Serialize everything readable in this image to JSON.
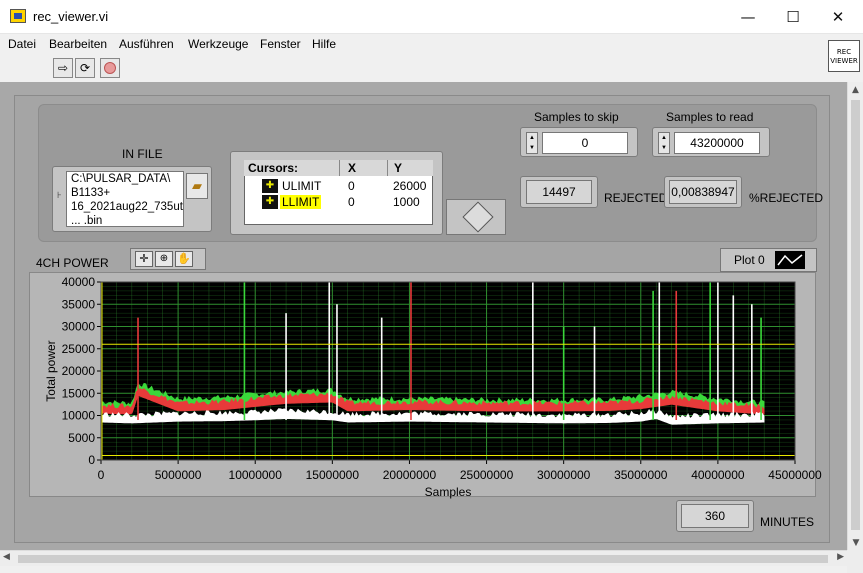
{
  "window": {
    "title": "rec_viewer.vi",
    "min": "—",
    "max": "☐",
    "close": "✕"
  },
  "menu": [
    "Datei",
    "Bearbeiten",
    "Ausführen",
    "Werkzeuge",
    "Fenster",
    "Hilfe"
  ],
  "vi_icon": {
    "line1": "REC",
    "line2": "VIEWER"
  },
  "infile": {
    "label": "IN FILE",
    "lines": [
      "C:\\PULSAR_DATA\\",
      "B1133+",
      "16_2021aug22_735ut",
      "... .bin"
    ]
  },
  "cursors": {
    "headers": [
      "Cursors:",
      "X",
      "Y"
    ],
    "rows": [
      {
        "name": "ULIMIT",
        "x": "0",
        "y": "26000"
      },
      {
        "name": "LLIMIT",
        "x": "0",
        "y": "1000"
      }
    ]
  },
  "skip": {
    "label": "Samples to skip",
    "value": "0"
  },
  "read": {
    "label": "Samples to read",
    "value": "43200000"
  },
  "rejected": {
    "value": "14497",
    "label": "REJECTED"
  },
  "pct_rejected": {
    "value": "0,00838947",
    "label": "%REJECTED"
  },
  "graph": {
    "label": "4CH POWER",
    "plot_legend": "Plot 0"
  },
  "minutes": {
    "value": "360",
    "label": "MINUTES"
  },
  "colors": {
    "plot_bg": "#000000",
    "grid": "#2f8f2f",
    "cursor": "#e8e800",
    "white_trace": "#ffffff",
    "red_trace": "#e83a3a",
    "green_trace": "#3ad83a"
  },
  "chart_data": {
    "type": "line",
    "title": "",
    "xlabel": "Samples",
    "ylabel": "Total power",
    "xlim": [
      0,
      45000000
    ],
    "ylim": [
      0,
      40000
    ],
    "x_ticks": [
      "0",
      "5000000",
      "10000000",
      "15000000",
      "20000000",
      "25000000",
      "30000000",
      "35000000",
      "40000000",
      "45000000"
    ],
    "y_ticks": [
      "0",
      "5000",
      "10000",
      "15000",
      "20000",
      "25000",
      "30000",
      "35000",
      "40000"
    ],
    "grid": true,
    "cursor_lines": [
      {
        "name": "ULIMIT",
        "y": 26000
      },
      {
        "name": "LLIMIT",
        "y": 1000
      }
    ],
    "series": [
      {
        "color": "green",
        "x": [
          0,
          2000000,
          2400000,
          5000000,
          8000000,
          10000000,
          12000000,
          15000000,
          16000000,
          20000000,
          25000000,
          30000000,
          33000000,
          35000000,
          37000000,
          40000000,
          43000000
        ],
        "y": [
          12800,
          12500,
          17000,
          13500,
          13800,
          14500,
          15000,
          15500,
          13500,
          13500,
          13200,
          13200,
          13300,
          14000,
          15000,
          13500,
          12500
        ]
      },
      {
        "color": "red",
        "x": [
          0,
          2000000,
          2400000,
          5000000,
          8000000,
          10000000,
          12000000,
          15000000,
          16000000,
          20000000,
          25000000,
          30000000,
          33000000,
          35000000,
          37000000,
          40000000,
          43000000
        ],
        "y": [
          12000,
          11800,
          16000,
          12500,
          12800,
          13500,
          14200,
          14500,
          12500,
          12800,
          12500,
          12500,
          12600,
          13000,
          14000,
          12500,
          11800
        ]
      },
      {
        "color": "white",
        "x": [
          0,
          2000000,
          5000000,
          8000000,
          10000000,
          12000000,
          15000000,
          16000000,
          20000000,
          25000000,
          30000000,
          33000000,
          35000000,
          36000000,
          37000000,
          40000000,
          43000000
        ],
        "y": [
          10000,
          9800,
          10200,
          10300,
          10500,
          10800,
          10500,
          10000,
          10200,
          10000,
          9800,
          9900,
          10200,
          10800,
          9500,
          9800,
          10000
        ]
      }
    ],
    "spikes": [
      {
        "x": 2400000,
        "y": 32000,
        "color": "red"
      },
      {
        "x": 9300000,
        "y": 40000,
        "color": "green"
      },
      {
        "x": 12000000,
        "y": 33000,
        "color": "white"
      },
      {
        "x": 14800000,
        "y": 40000,
        "color": "white"
      },
      {
        "x": 15300000,
        "y": 35000,
        "color": "white"
      },
      {
        "x": 18200000,
        "y": 32000,
        "color": "white"
      },
      {
        "x": 20100000,
        "y": 40000,
        "color": "red"
      },
      {
        "x": 28000000,
        "y": 40000,
        "color": "white"
      },
      {
        "x": 30000000,
        "y": 30000,
        "color": "green"
      },
      {
        "x": 32000000,
        "y": 30000,
        "color": "white"
      },
      {
        "x": 35800000,
        "y": 38000,
        "color": "green"
      },
      {
        "x": 36200000,
        "y": 40000,
        "color": "white"
      },
      {
        "x": 37300000,
        "y": 38000,
        "color": "red"
      },
      {
        "x": 39500000,
        "y": 40000,
        "color": "green"
      },
      {
        "x": 40000000,
        "y": 40000,
        "color": "white"
      },
      {
        "x": 41000000,
        "y": 37000,
        "color": "white"
      },
      {
        "x": 42200000,
        "y": 35000,
        "color": "white"
      },
      {
        "x": 42800000,
        "y": 32000,
        "color": "green"
      }
    ]
  }
}
